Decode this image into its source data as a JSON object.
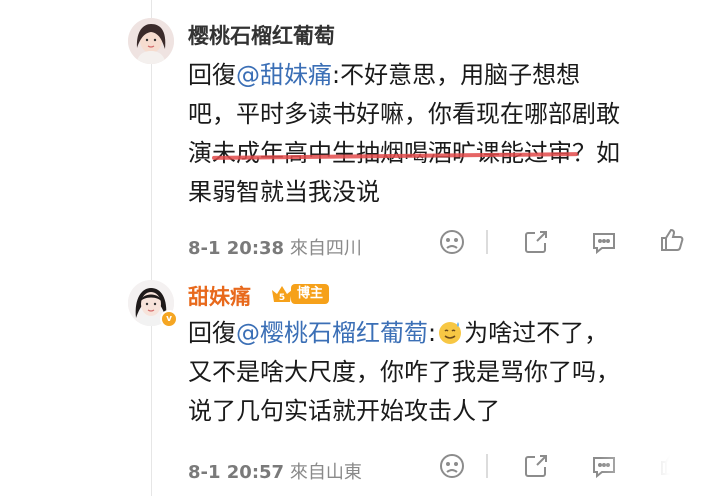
{
  "comments": [
    {
      "username": "樱桃石榴红葡萄",
      "reply_prefix": "回復",
      "mention": "@甜妹痛",
      "text_part1": ":不好意思，用脑子想想",
      "text_part2": "吧，平时多读书好嘛，你看现在哪部剧敢",
      "text_part3_pre": "演",
      "text_part3_strike": "未成年高中生抽烟喝酒旷课能过审",
      "text_part3_post": "？如",
      "text_part4": "果弱智就当我没说",
      "time": "8-1 20:38",
      "location": "來自四川"
    },
    {
      "username": "甜妹痛",
      "badge_level": "5",
      "badge_label": "博主",
      "reply_prefix": "回復",
      "mention": "@樱桃石榴红葡萄",
      "text_colon": ":",
      "text_part1": "为啥过不了，",
      "text_part2": "又不是啥大尺度，你咋了我是骂你了吗，",
      "text_part3": "说了几句实话就开始攻击人了",
      "time": "8-1 20:57",
      "location": "來自山東"
    }
  ],
  "icons": {
    "dislike": "sad-face-icon",
    "repost": "share-icon",
    "reply": "comment-icon",
    "like": "thumbs-up-icon",
    "emoji": "sweat-smile-emoji"
  },
  "colors": {
    "mention": "#3b6fb6",
    "vip_name": "#e8691c",
    "badge": "#f6a11a",
    "strike": "#e24a4a"
  }
}
